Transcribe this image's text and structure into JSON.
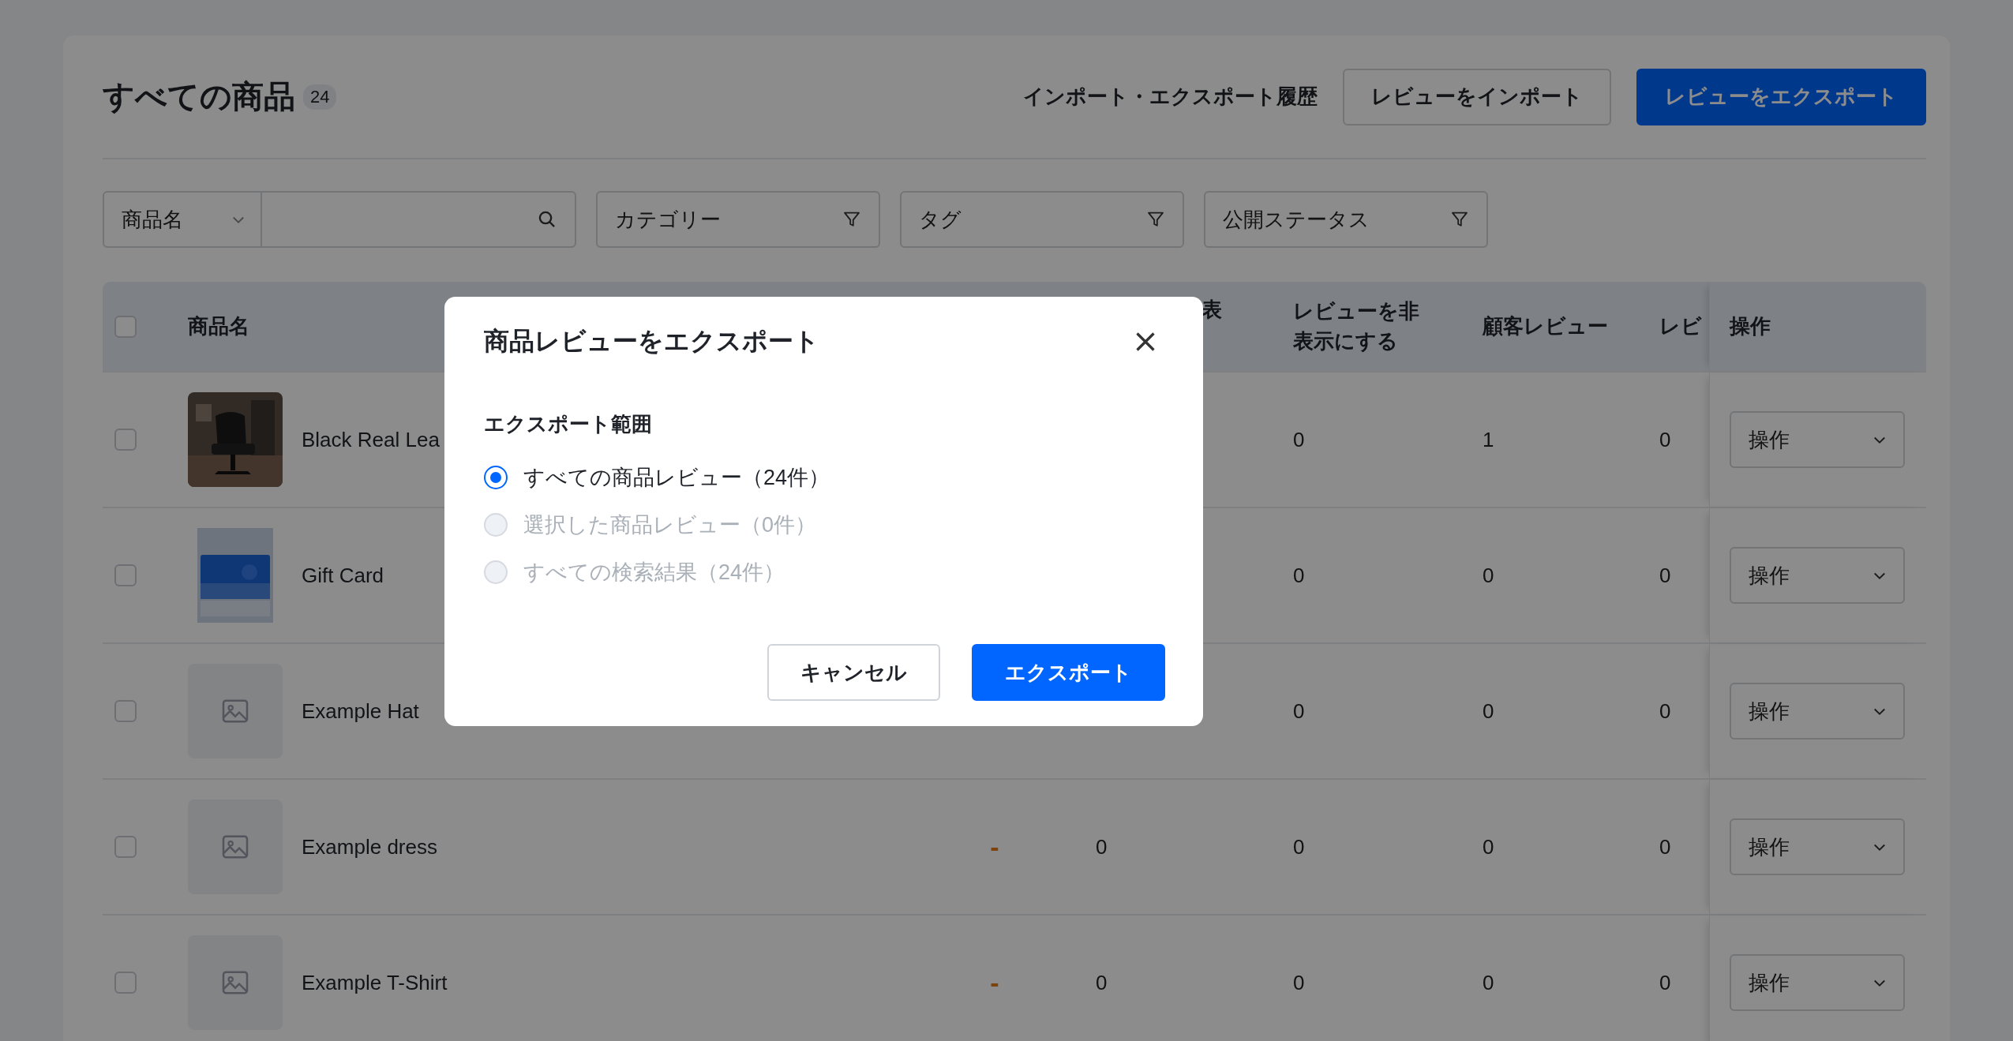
{
  "page": {
    "title": "すべての商品",
    "count": "24",
    "history_link": "インポート・エクスポート履歴",
    "import_button": "レビューをインポート",
    "export_button": "レビューをエクスポート"
  },
  "filters": {
    "field_select": "商品名",
    "category": "カテゴリー",
    "tag": "タグ",
    "status": "公開ステータス"
  },
  "table": {
    "select_all_checked": false,
    "columns": {
      "name": "商品名",
      "column_3": "表",
      "hidden": "レビューを非表示にする",
      "customer": "顧客レビュー",
      "column_6": "レビ",
      "actions": "操作"
    },
    "rows": [
      {
        "checked": false,
        "kind": "picture",
        "name": "Black Real Lea",
        "hidden": "0",
        "customer": "1",
        "column_6": "0",
        "action": "操作"
      },
      {
        "checked": false,
        "kind": "picture",
        "name": "Gift Card",
        "hidden": "0",
        "customer": "0",
        "column_6": "0",
        "action": "操作"
      },
      {
        "checked": false,
        "kind": "placeholder",
        "name": "Example Hat",
        "hidden": "0",
        "customer": "0",
        "column_6": "0",
        "action": "操作"
      },
      {
        "checked": false,
        "kind": "placeholder",
        "name": "Example dress",
        "status": "-",
        "column_3": "0",
        "hidden": "0",
        "customer": "0",
        "column_6": "0",
        "action": "操作"
      },
      {
        "checked": false,
        "kind": "placeholder",
        "name": "Example T-Shirt",
        "status": "-",
        "column_3": "0",
        "hidden": "0",
        "customer": "0",
        "column_6": "0",
        "action": "操作"
      }
    ]
  },
  "modal": {
    "title": "商品レビューをエクスポート",
    "section_label": "エクスポート範囲",
    "options": [
      {
        "label": "すべての商品レビュー（24件）",
        "selected": true,
        "disabled": false
      },
      {
        "label": "選択した商品レビュー（0件）",
        "selected": false,
        "disabled": true
      },
      {
        "label": "すべての検索結果（24件）",
        "selected": false,
        "disabled": true
      }
    ],
    "cancel_button": "キャンセル",
    "confirm_button": "エクスポート"
  }
}
